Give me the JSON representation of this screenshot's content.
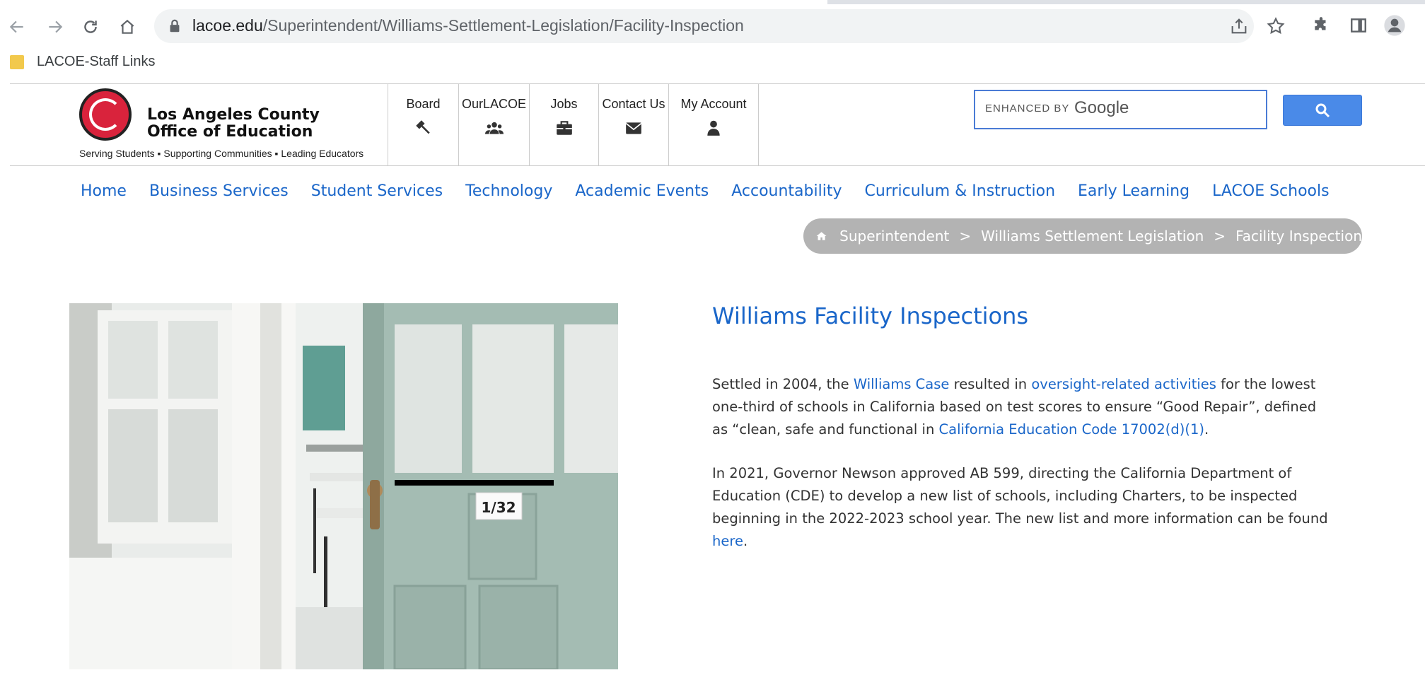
{
  "browser": {
    "url_domain": "lacoe.edu",
    "url_path": "/Superintendent/Williams-Settlement-Legislation/Facility-Inspection",
    "bookmark_label": "LACOE-Staff Links"
  },
  "header": {
    "logo_line1": "Los Angeles County",
    "logo_line2": "Office of Education",
    "tagline": "Serving Students ▪ Supporting Communities ▪ Leading Educators",
    "topnav": [
      {
        "label": "Board",
        "icon": "gavel-icon"
      },
      {
        "label": "OurLACOE",
        "icon": "users-icon"
      },
      {
        "label": "Jobs",
        "icon": "briefcase-icon"
      },
      {
        "label": "Contact Us",
        "icon": "envelope-icon"
      },
      {
        "label": "My Account",
        "icon": "user-icon"
      }
    ],
    "search_enhanced": "ENHANCED BY",
    "search_google": "Google"
  },
  "mainnav": [
    "Home",
    "Business Services",
    "Student Services",
    "Technology",
    "Academic Events",
    "Accountability",
    "Curriculum & Instruction",
    "Early Learning",
    "LACOE Schools"
  ],
  "breadcrumb": [
    "Superintendent",
    "Williams Settlement Legislation",
    "Facility Inspection"
  ],
  "breadcrumb_sep": ">",
  "photo": {
    "door_sign": "1/32"
  },
  "content": {
    "title": "Williams Facility Inspections",
    "p1_a": "Settled in 2004, the ",
    "p1_link1": "Williams Case",
    "p1_b": " resulted in ",
    "p1_link2": "oversight-related activities",
    "p1_c": " for the lowest one-third of schools in California based on test scores to ensure “Good Repair”, defined as “clean, safe and functional in ",
    "p1_link3": "California Education Code 17002(d)(1)",
    "p1_d": ".",
    "p2_a": "In 2021, Governor Newson approved AB 599, directing the California Department of Education (CDE) to develop a new list of schools, including Charters, to be inspected beginning in the 2022-2023 school year. The new list and more information can be found ",
    "p2_link": "here",
    "p2_b": "."
  }
}
